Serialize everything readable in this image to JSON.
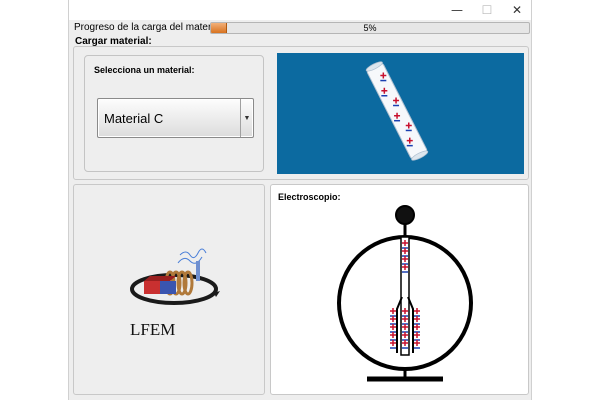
{
  "window": {
    "controls": {
      "minimize": "—",
      "maximize": "☐",
      "close": "✕"
    }
  },
  "progress": {
    "label": "Progreso de la carga del material:",
    "value_percent": 5,
    "text": "5%",
    "fill_color": "#e08a3a"
  },
  "load_section": {
    "label": "Cargar material:"
  },
  "material_selector": {
    "title": "Selecciona un material:",
    "selected": "Material C",
    "arrow_icon": "▼"
  },
  "material_view": {
    "background": "#0c6aa0",
    "charge_symbol": "+-"
  },
  "logo": {
    "text": "LFEM"
  },
  "electroscope": {
    "title": "Electroscopio:"
  }
}
